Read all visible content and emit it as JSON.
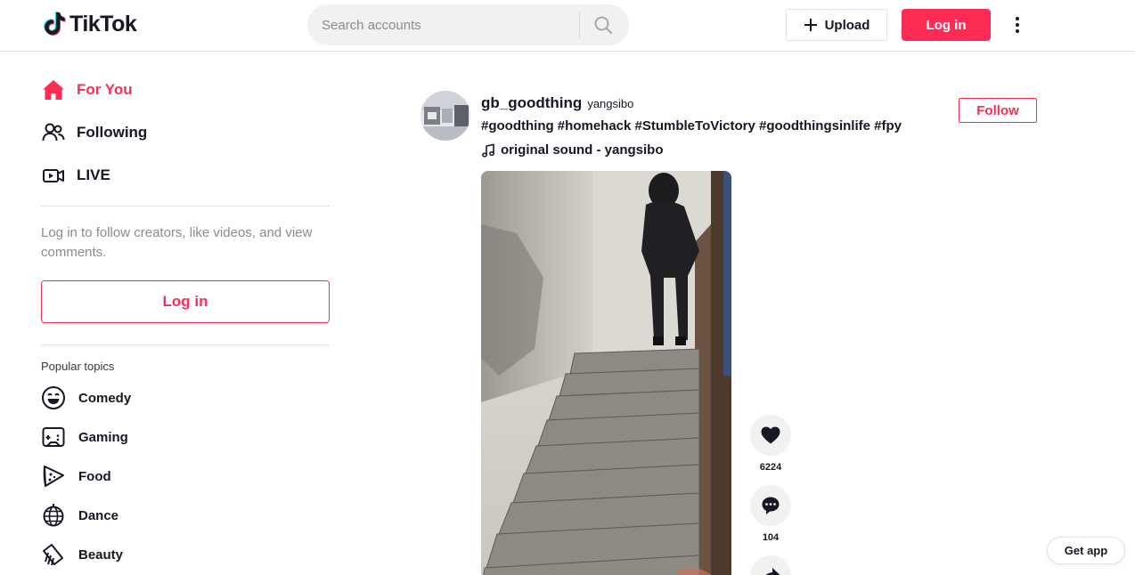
{
  "header": {
    "logo_text": "TikTok",
    "search_placeholder": "Search accounts",
    "upload_label": "Upload",
    "login_label": "Log in",
    "more_icon": "more-vertical-icon"
  },
  "sidebar": {
    "nav": [
      {
        "label": "For You",
        "icon": "home-icon",
        "active": true
      },
      {
        "label": "Following",
        "icon": "people-icon",
        "active": false
      },
      {
        "label": "LIVE",
        "icon": "live-camera-icon",
        "active": false
      }
    ],
    "login_hint": "Log in to follow creators, like videos, and view comments.",
    "login_button": "Log in",
    "topics_title": "Popular topics",
    "topics": [
      {
        "label": "Comedy",
        "icon": "laugh-face-icon"
      },
      {
        "label": "Gaming",
        "icon": "gamepad-icon"
      },
      {
        "label": "Food",
        "icon": "pizza-icon"
      },
      {
        "label": "Dance",
        "icon": "disco-ball-icon"
      },
      {
        "label": "Beauty",
        "icon": "comb-icon"
      }
    ]
  },
  "post": {
    "username": "gb_goodthing",
    "nickname": "yangsibo",
    "caption": "#goodthing #homehack #StumbleToVictory #goodthingsinlife #fpy",
    "sound": "original sound - yangsibo",
    "follow_label": "Follow",
    "likes": "6224",
    "comments": "104"
  },
  "footer": {
    "get_app": "Get app"
  },
  "colors": {
    "brand": "#fe2c55",
    "text": "#161823",
    "muted": "#8a8b91"
  }
}
